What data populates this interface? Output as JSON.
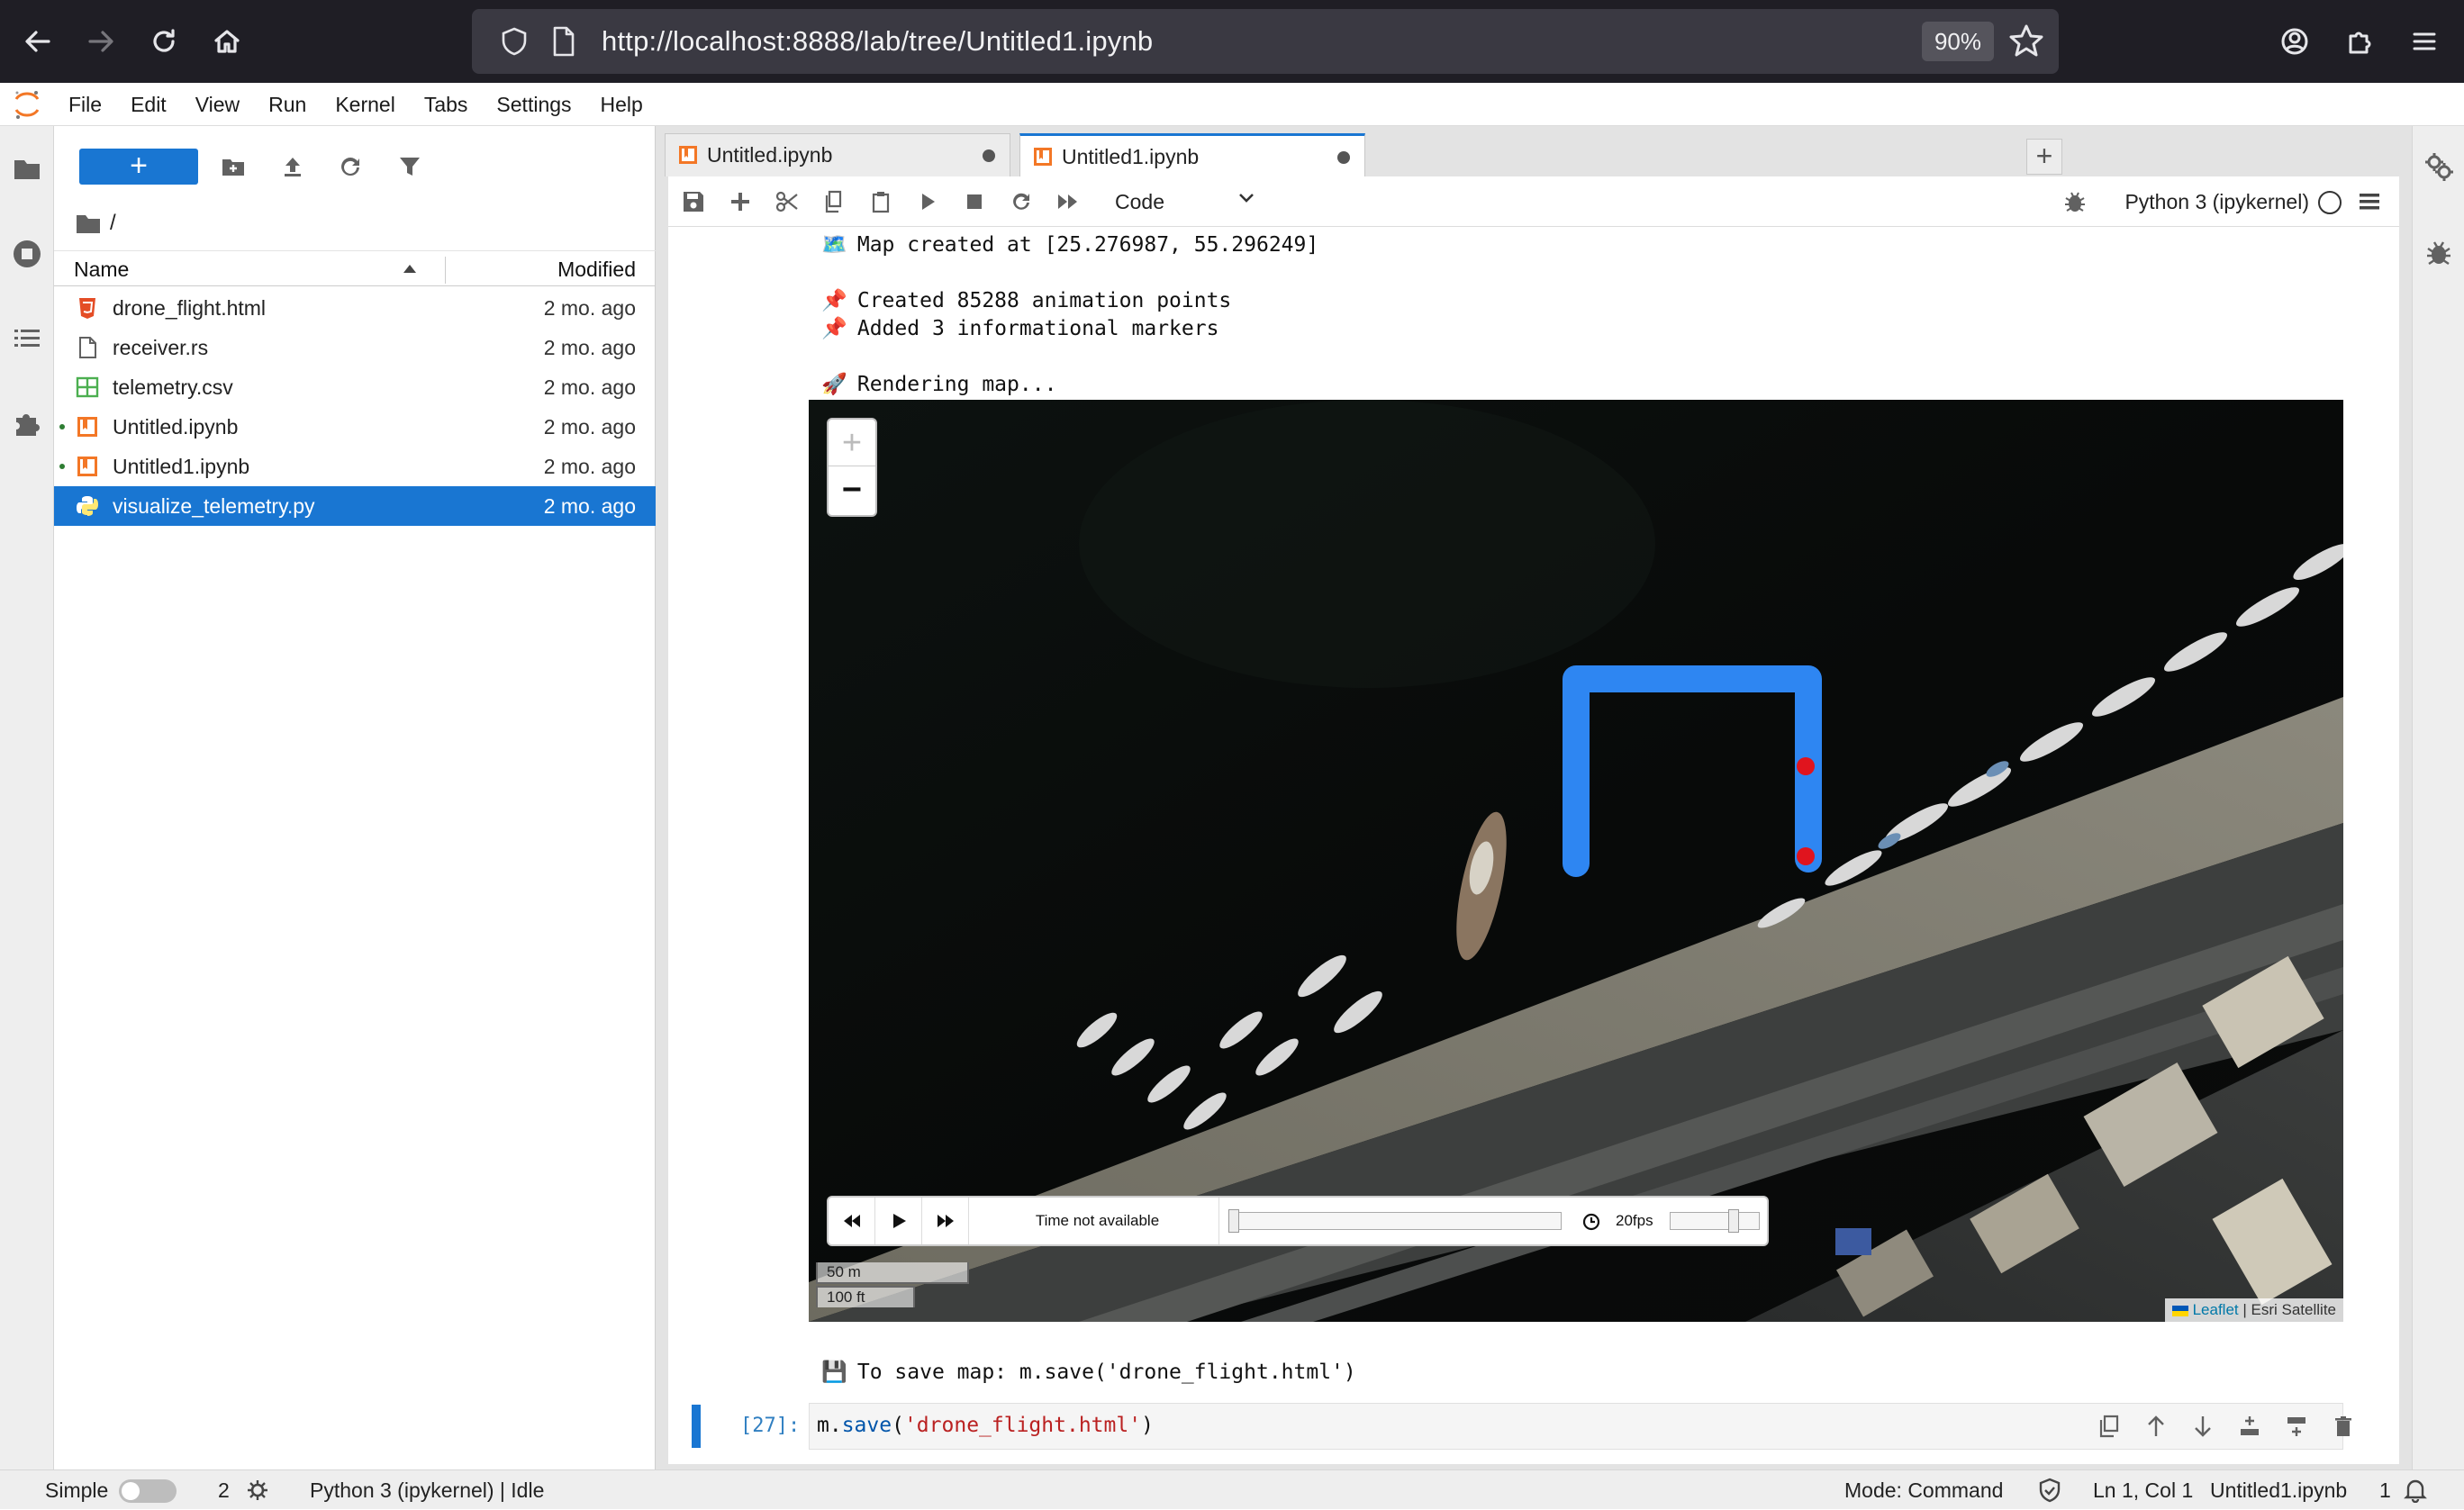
{
  "browser": {
    "url": "http://localhost:8888/lab/tree/Untitled1.ipynb",
    "zoom": "90%"
  },
  "menubar": {
    "items": [
      "File",
      "Edit",
      "View",
      "Run",
      "Kernel",
      "Tabs",
      "Settings",
      "Help"
    ]
  },
  "filebrowser": {
    "new_button": "+",
    "breadcrumb": "/",
    "col_name": "Name",
    "col_modified": "Modified",
    "files": [
      {
        "name": "drone_flight.html",
        "modified": "2 mo. ago",
        "type": "html",
        "running": false,
        "selected": false
      },
      {
        "name": "receiver.rs",
        "modified": "2 mo. ago",
        "type": "file",
        "running": false,
        "selected": false
      },
      {
        "name": "telemetry.csv",
        "modified": "2 mo. ago",
        "type": "csv",
        "running": false,
        "selected": false
      },
      {
        "name": "Untitled.ipynb",
        "modified": "2 mo. ago",
        "type": "notebook",
        "running": true,
        "selected": false
      },
      {
        "name": "Untitled1.ipynb",
        "modified": "2 mo. ago",
        "type": "notebook",
        "running": true,
        "selected": false
      },
      {
        "name": "visualize_telemetry.py",
        "modified": "2 mo. ago",
        "type": "python",
        "running": false,
        "selected": true
      }
    ]
  },
  "tabs": [
    {
      "label": "Untitled.ipynb",
      "active": false
    },
    {
      "label": "Untitled1.ipynb",
      "active": true
    }
  ],
  "new_tab": "+",
  "notebook": {
    "cell_type": "Code",
    "kernel": "Python 3 (ipykernel)",
    "output_lines": [
      {
        "icon": "🗺️",
        "text": "Map created at [25.276987, 55.296249]"
      },
      {
        "icon": "📌",
        "text": "Created 85288 animation points"
      },
      {
        "icon": "📌",
        "text": "Added 3 informational markers"
      },
      {
        "icon": "🚀",
        "text": "Rendering map..."
      }
    ],
    "save_hint": {
      "icon": "💾",
      "text": "To save map: m.save('drone_flight.html')"
    },
    "cell": {
      "prompt": "[27]:",
      "code_obj": "m.",
      "code_fn": "save",
      "code_open": "(",
      "code_str": "'drone_flight.html'",
      "code_close": ")"
    }
  },
  "map": {
    "zoom_in": "+",
    "zoom_out": "−",
    "time_label": "Time not available",
    "fps": "20fps",
    "scale_metric": "50 m",
    "scale_imperial": "100 ft",
    "attribution_leaflet": "Leaflet",
    "attribution_sep": " | ",
    "attribution_source": "Esri Satellite",
    "path_color": "#2e86f2",
    "marker_color": "#e0141e"
  },
  "statusbar": {
    "mode_label": "Simple",
    "terminal_count": "2",
    "kernel_status": "Python 3 (ipykernel) | Idle",
    "mode": "Mode: Command",
    "cursor": "Ln 1, Col 1",
    "filename": "Untitled1.ipynb",
    "notifications": "1"
  },
  "colors": {
    "accent": "#1976d2",
    "browser_bg": "#1f1e25"
  }
}
